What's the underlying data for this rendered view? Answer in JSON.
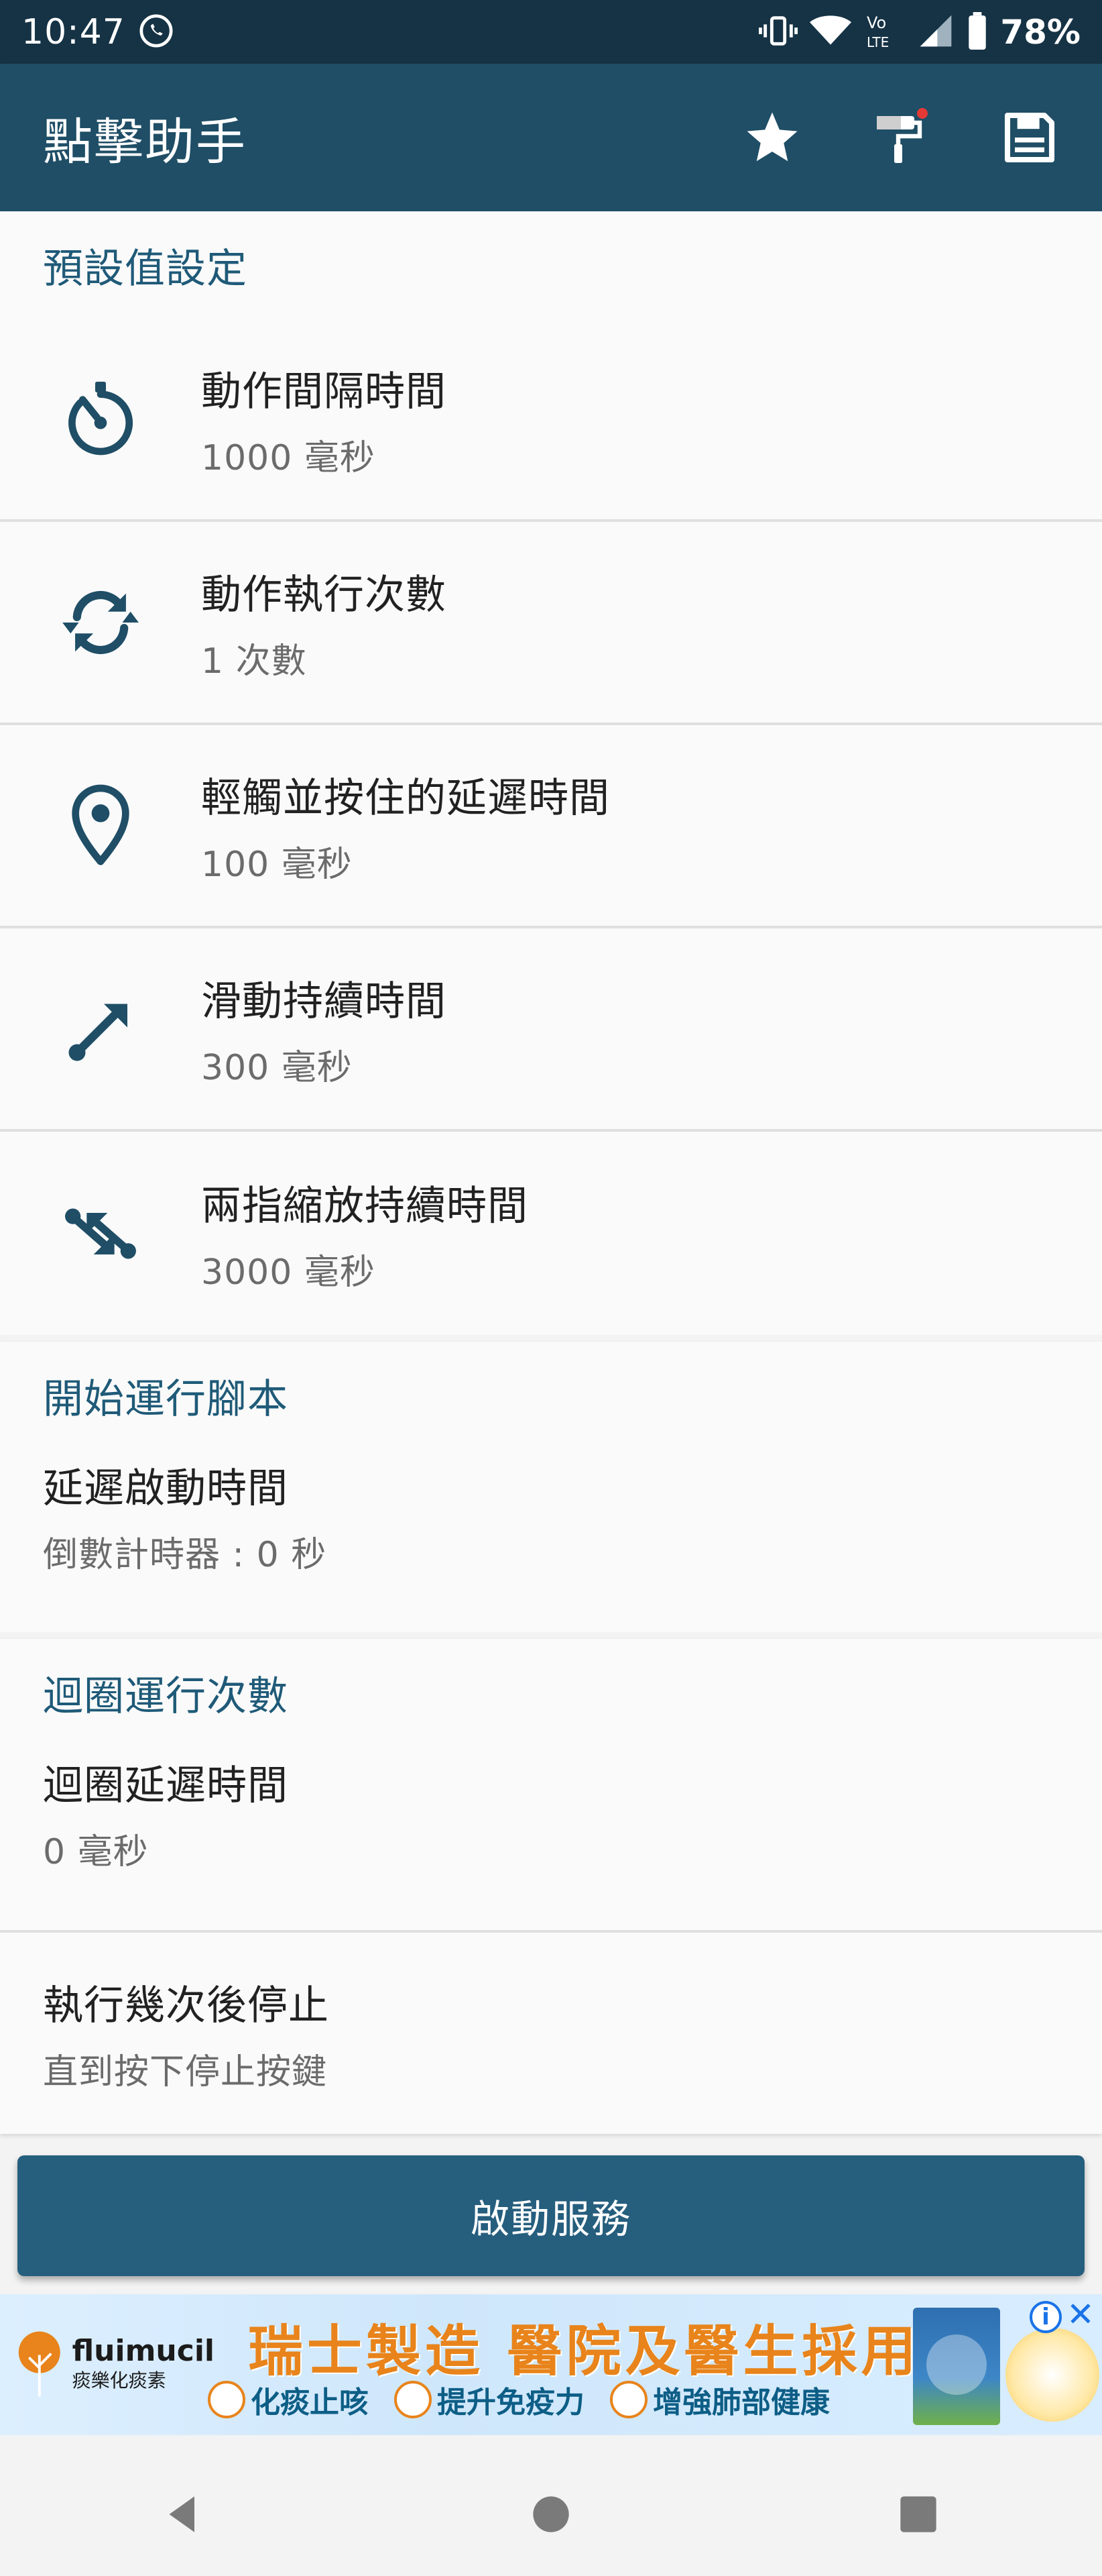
{
  "status_bar": {
    "time": "10:47",
    "battery": "78%",
    "icons": [
      "whatsapp-icon",
      "vibrate-icon",
      "wifi-icon",
      "volte-icon",
      "signal-icon",
      "battery-icon"
    ]
  },
  "toolbar": {
    "title": "點擊助手",
    "actions": [
      "star-icon",
      "paint-roller-icon",
      "save-icon"
    ],
    "colors": {
      "bar": "#1f4e66",
      "status": "#163345"
    }
  },
  "defaults_section": {
    "header": "預設值設定",
    "items": [
      {
        "icon": "timer-icon",
        "title": "動作間隔時間",
        "value": "1000 毫秒"
      },
      {
        "icon": "sync-icon",
        "title": "動作執行次數",
        "value": "1 次數"
      },
      {
        "icon": "location-pin-icon",
        "title": "輕觸並按住的延遲時間",
        "value": "100 毫秒"
      },
      {
        "icon": "swipe-arrow-icon",
        "title": "滑動持續時間",
        "value": "300 毫秒"
      },
      {
        "icon": "pinch-arrows-icon",
        "title": "兩指縮放持續時間",
        "value": "3000 毫秒"
      }
    ]
  },
  "start_section": {
    "header": "開始運行腳本",
    "items": [
      {
        "title": "延遲啟動時間",
        "value": "倒數計時器 : 0 秒"
      }
    ]
  },
  "loop_section": {
    "header": "迴圈運行次數",
    "items": [
      {
        "title": "迴圈延遲時間",
        "value": "0 毫秒"
      },
      {
        "title": "執行幾次後停止",
        "value": "直到按下停止按鍵"
      }
    ]
  },
  "start_button": {
    "label": "啟動服務",
    "color": "#265e7e"
  },
  "ad": {
    "brand": "fluimucil",
    "brand_sub": "痰樂化痰素",
    "headline": "瑞士製造  醫院及醫生採用",
    "features": [
      "化痰止咳",
      "提升免疫力",
      "增強肺部健康"
    ]
  },
  "nav": [
    "back-icon",
    "home-icon",
    "recents-icon"
  ]
}
